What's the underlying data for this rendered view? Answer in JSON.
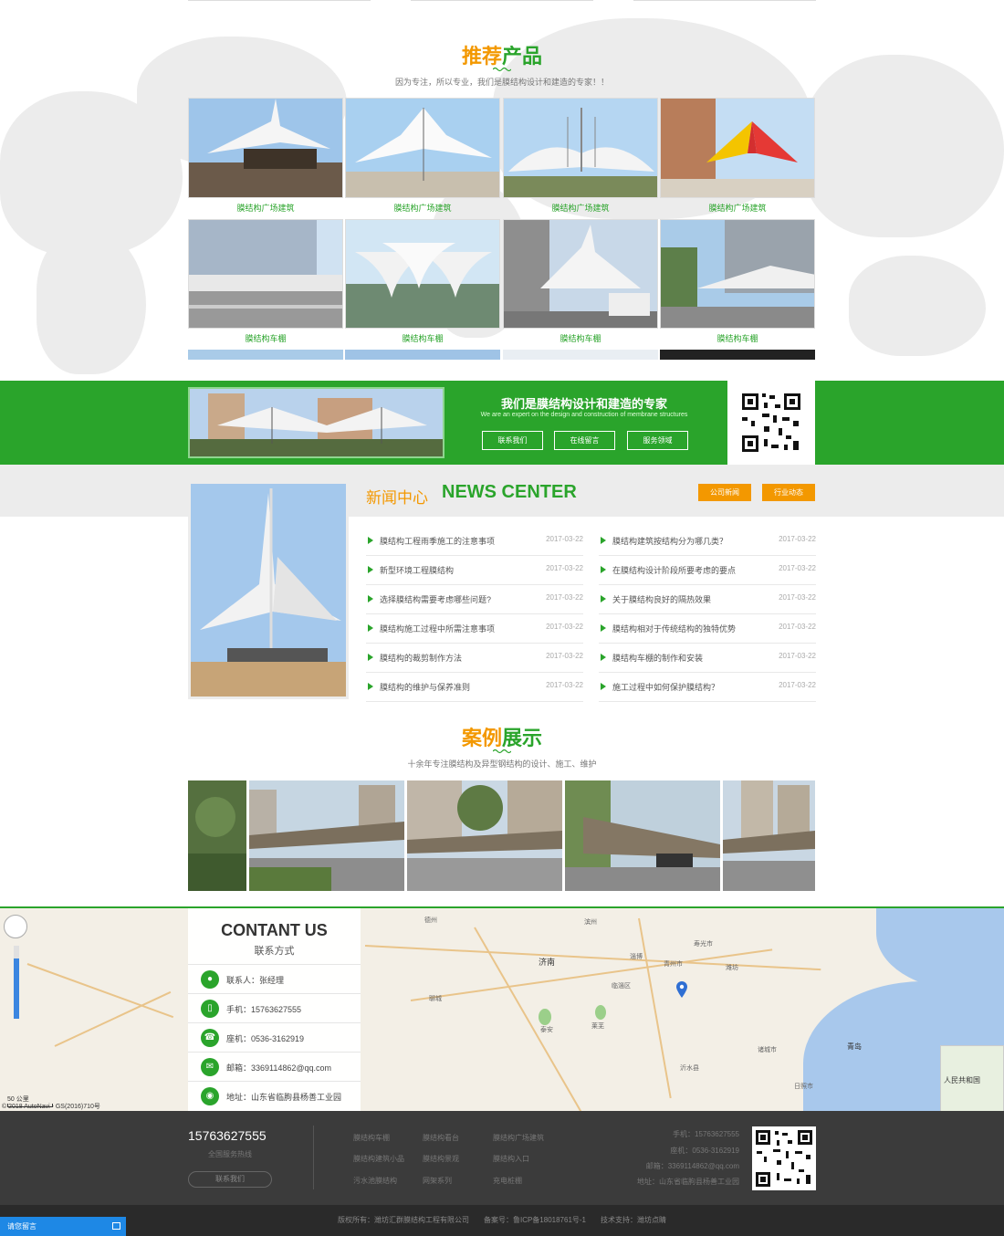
{
  "products": {
    "title_part1": "推荐",
    "title_part2": "产品",
    "subtitle": "因为专注，所以专业，我们是膜结构设计和建造的专家！！",
    "items": [
      {
        "caption": "膜结构广场建筑"
      },
      {
        "caption": "膜结构广场建筑"
      },
      {
        "caption": "膜结构广场建筑"
      },
      {
        "caption": "膜结构广场建筑"
      },
      {
        "caption": "膜结构车棚"
      },
      {
        "caption": "膜结构车棚"
      },
      {
        "caption": "膜结构车棚"
      },
      {
        "caption": "膜结构车棚"
      }
    ]
  },
  "banner": {
    "title": "我们是膜结构设计和建造的专家",
    "subtitle": "We are an expert on the design and construction of membrane structures",
    "buttons": [
      "联系我们",
      "在线留言",
      "服务领域"
    ]
  },
  "news": {
    "title_cn": "新闻中心",
    "title_en": "NEWS CENTER",
    "tabs": [
      "公司新闻",
      "行业动态"
    ],
    "left": [
      {
        "title": "膜结构工程雨季施工的注意事项",
        "date": "2017-03-22"
      },
      {
        "title": "新型环境工程膜结构",
        "date": "2017-03-22"
      },
      {
        "title": "选择膜结构需要考虑哪些问题?",
        "date": "2017-03-22"
      },
      {
        "title": "膜结构施工过程中所需注意事项",
        "date": "2017-03-22"
      },
      {
        "title": "膜结构的裁剪制作方法",
        "date": "2017-03-22"
      },
      {
        "title": "膜结构的维护与保养准则",
        "date": "2017-03-22"
      }
    ],
    "right": [
      {
        "title": "膜结构建筑按结构分为哪几类？",
        "date": "2017-03-22"
      },
      {
        "title": "在膜结构设计阶段所要考虑的要点",
        "date": "2017-03-22"
      },
      {
        "title": "关于膜结构良好的隔热效果",
        "date": "2017-03-22"
      },
      {
        "title": "膜结构相对于传统结构的独特优势",
        "date": "2017-03-22"
      },
      {
        "title": "膜结构车棚的制作和安装",
        "date": "2017-03-22"
      },
      {
        "title": "施工过程中如何保护膜结构？",
        "date": "2017-03-22"
      }
    ]
  },
  "cases": {
    "title_part1": "案例",
    "title_part2": "展示",
    "subtitle": "十余年专注膜结构及异型钢结构的设计、施工、维护"
  },
  "contact": {
    "title_en": "CONTANT US",
    "title_cn": "联系方式",
    "rows": [
      {
        "text": "联系人：张经理",
        "icon": "person-icon"
      },
      {
        "text": "手机：15763627555",
        "icon": "mobile-icon"
      },
      {
        "text": "座机：0536-3162919",
        "icon": "phone-icon"
      },
      {
        "text": "邮箱：3369114862@qq.com",
        "icon": "mail-icon"
      },
      {
        "text": "地址：山东省临朐县杨善工业园",
        "icon": "location-icon"
      }
    ]
  },
  "map": {
    "scale": "50 公里",
    "credit": "© 2018 AutoNavi - GS(2016)710号",
    "labels": [
      {
        "text": "济南"
      },
      {
        "text": "淄博"
      },
      {
        "text": "潍坊"
      },
      {
        "text": "青州市"
      },
      {
        "text": "泰安"
      },
      {
        "text": "莱芜"
      },
      {
        "text": "聊城"
      },
      {
        "text": "青岛"
      },
      {
        "text": "日照市"
      },
      {
        "text": "沂水县"
      },
      {
        "text": "德州"
      },
      {
        "text": "滨州"
      },
      {
        "text": "临淄区"
      },
      {
        "text": "寿光市"
      },
      {
        "text": "诸城市"
      },
      {
        "text": "人民共和国"
      }
    ]
  },
  "footer": {
    "phone": "15763627555",
    "hotline_label": "全国服务热线",
    "contact_btn": "联系我们",
    "links": [
      "膜结构车棚",
      "膜结构看台",
      "膜结构广场建筑",
      "膜结构建筑小品",
      "膜结构景观",
      "膜结构入口",
      "污水池膜结构",
      "网架系列",
      "充电桩棚"
    ],
    "info": [
      "手机：15763627555",
      "座机：0536-3162919",
      "邮箱：3369114862@qq.com",
      "地址：山东省临朐县杨善工业园"
    ],
    "copyright": "版权所有：潍坊汇群膜结构工程有限公司　　备案号：鲁ICP备18018761号-1　　技术支持：潍坊点睛",
    "msg_button": "请您留言"
  },
  "colors": {
    "green": "#2aa42b",
    "orange": "#f39800",
    "dark": "#3b3b3b"
  }
}
